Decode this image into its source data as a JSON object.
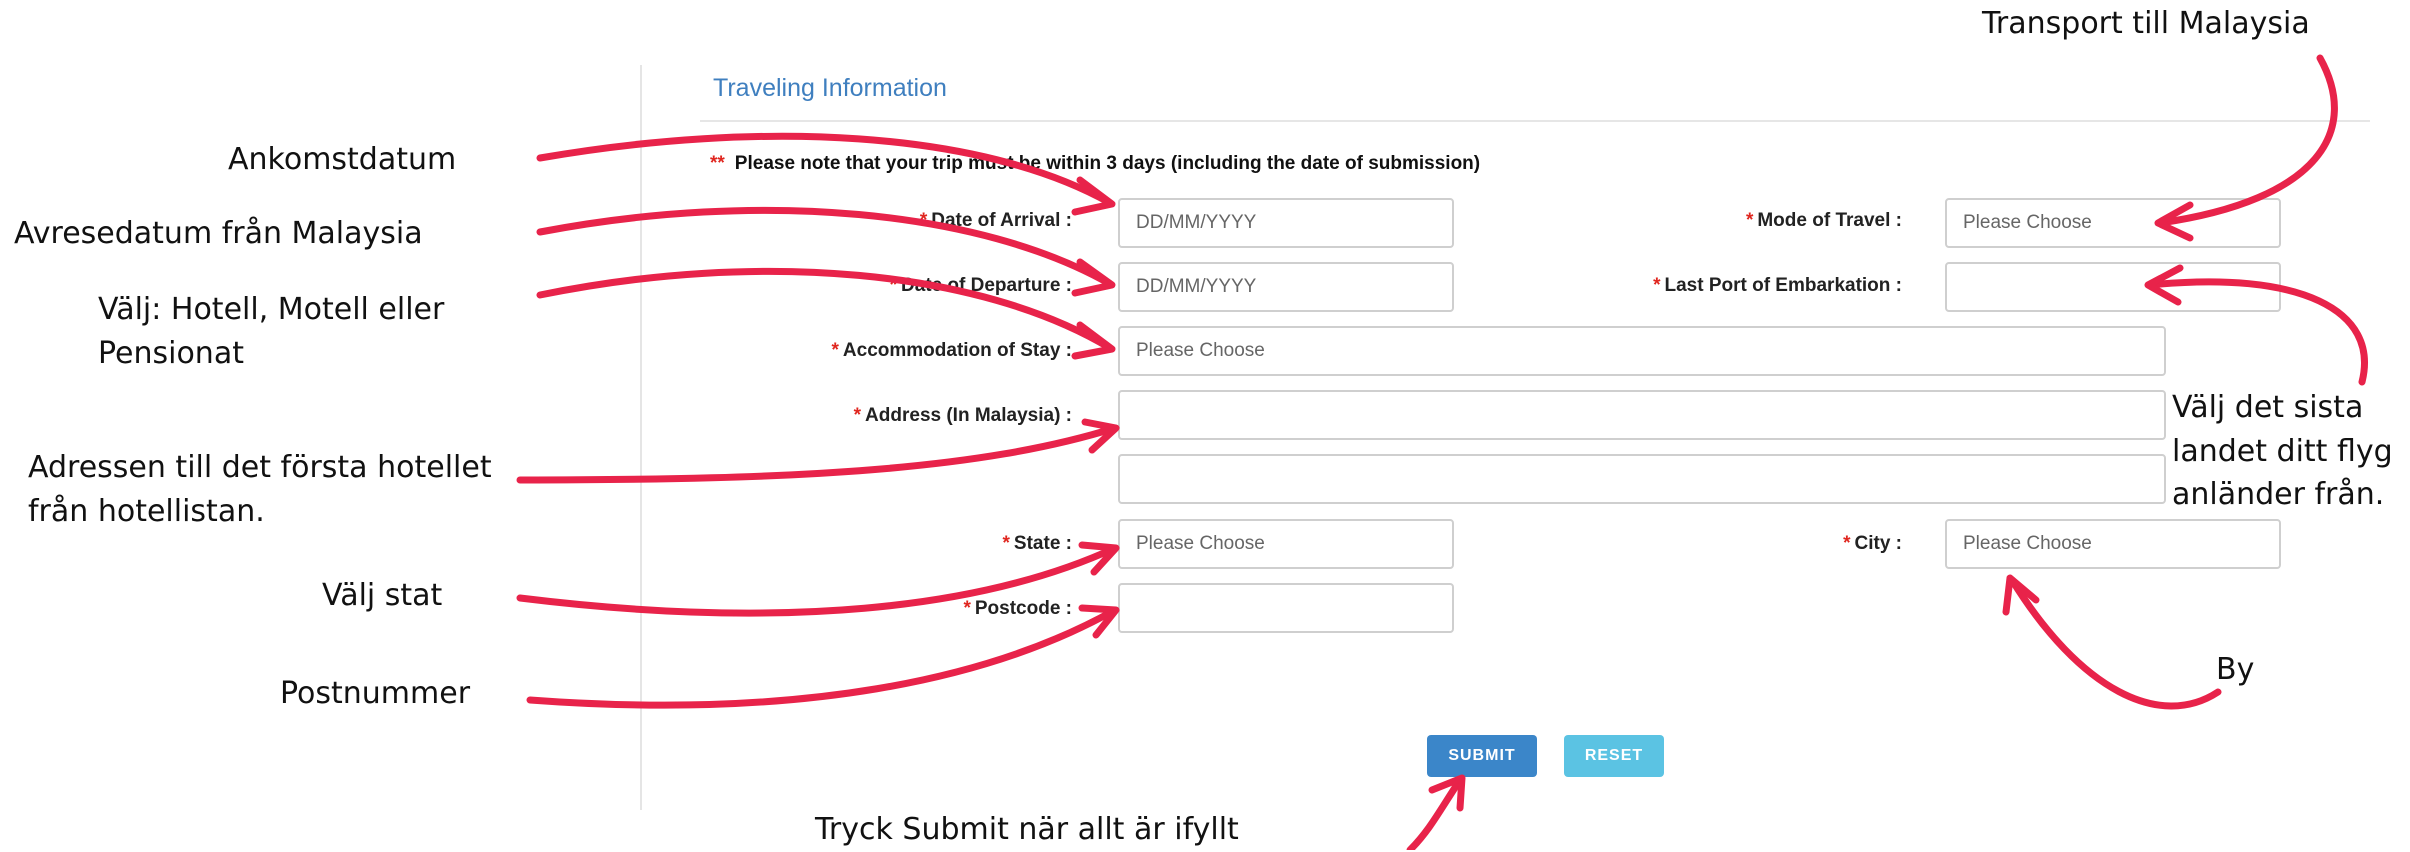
{
  "form": {
    "section_title": "Traveling Information",
    "note_marker": "**",
    "note": "Please note that your trip must be within 3 days (including the date of submission)",
    "required_marker": "*",
    "date_of_arrival_label": "Date of Arrival :",
    "date_of_arrival_placeholder": "DD/MM/YYYY",
    "mode_of_travel_label": "Mode of Travel :",
    "mode_of_travel_value": "Please Choose",
    "date_of_departure_label": "Date of Departure :",
    "date_of_departure_placeholder": "DD/MM/YYYY",
    "last_port_label": "Last Port of Embarkation :",
    "last_port_value": "",
    "accommodation_label": "Accommodation of Stay :",
    "accommodation_value": "Please Choose",
    "address_label": "Address (In Malaysia) :",
    "address_line1": "",
    "address_line2": "",
    "state_label": "State :",
    "state_value": "Please Choose",
    "city_label": "City :",
    "city_value": "Please Choose",
    "postcode_label": "Postcode :",
    "postcode_value": "",
    "submit_label": "SUBMIT",
    "reset_label": "RESET"
  },
  "annotations": {
    "transport": "Transport till Malaysia",
    "arrival": "Ankomstdatum",
    "departure": "Avresedatum från Malaysia",
    "accommodation_line1": "Välj: Hotell, Motell eller",
    "accommodation_line2": "Pensionat",
    "address_line1": "Adressen till det första hotellet",
    "address_line2": "från hotellistan.",
    "state": "Välj stat",
    "postcode": "Postnummer",
    "last_port_line1": "Välj det sista",
    "last_port_line2": "landet ditt flyg",
    "last_port_line3": "anländer från.",
    "city": "By",
    "submit": "Tryck Submit när allt är ifyllt"
  },
  "colors": {
    "accent_title": "#3f7fbf",
    "required": "#e0261f",
    "arrow": "#e8234a",
    "submit_button": "#3b86c9",
    "reset_button": "#5bc3e3"
  }
}
